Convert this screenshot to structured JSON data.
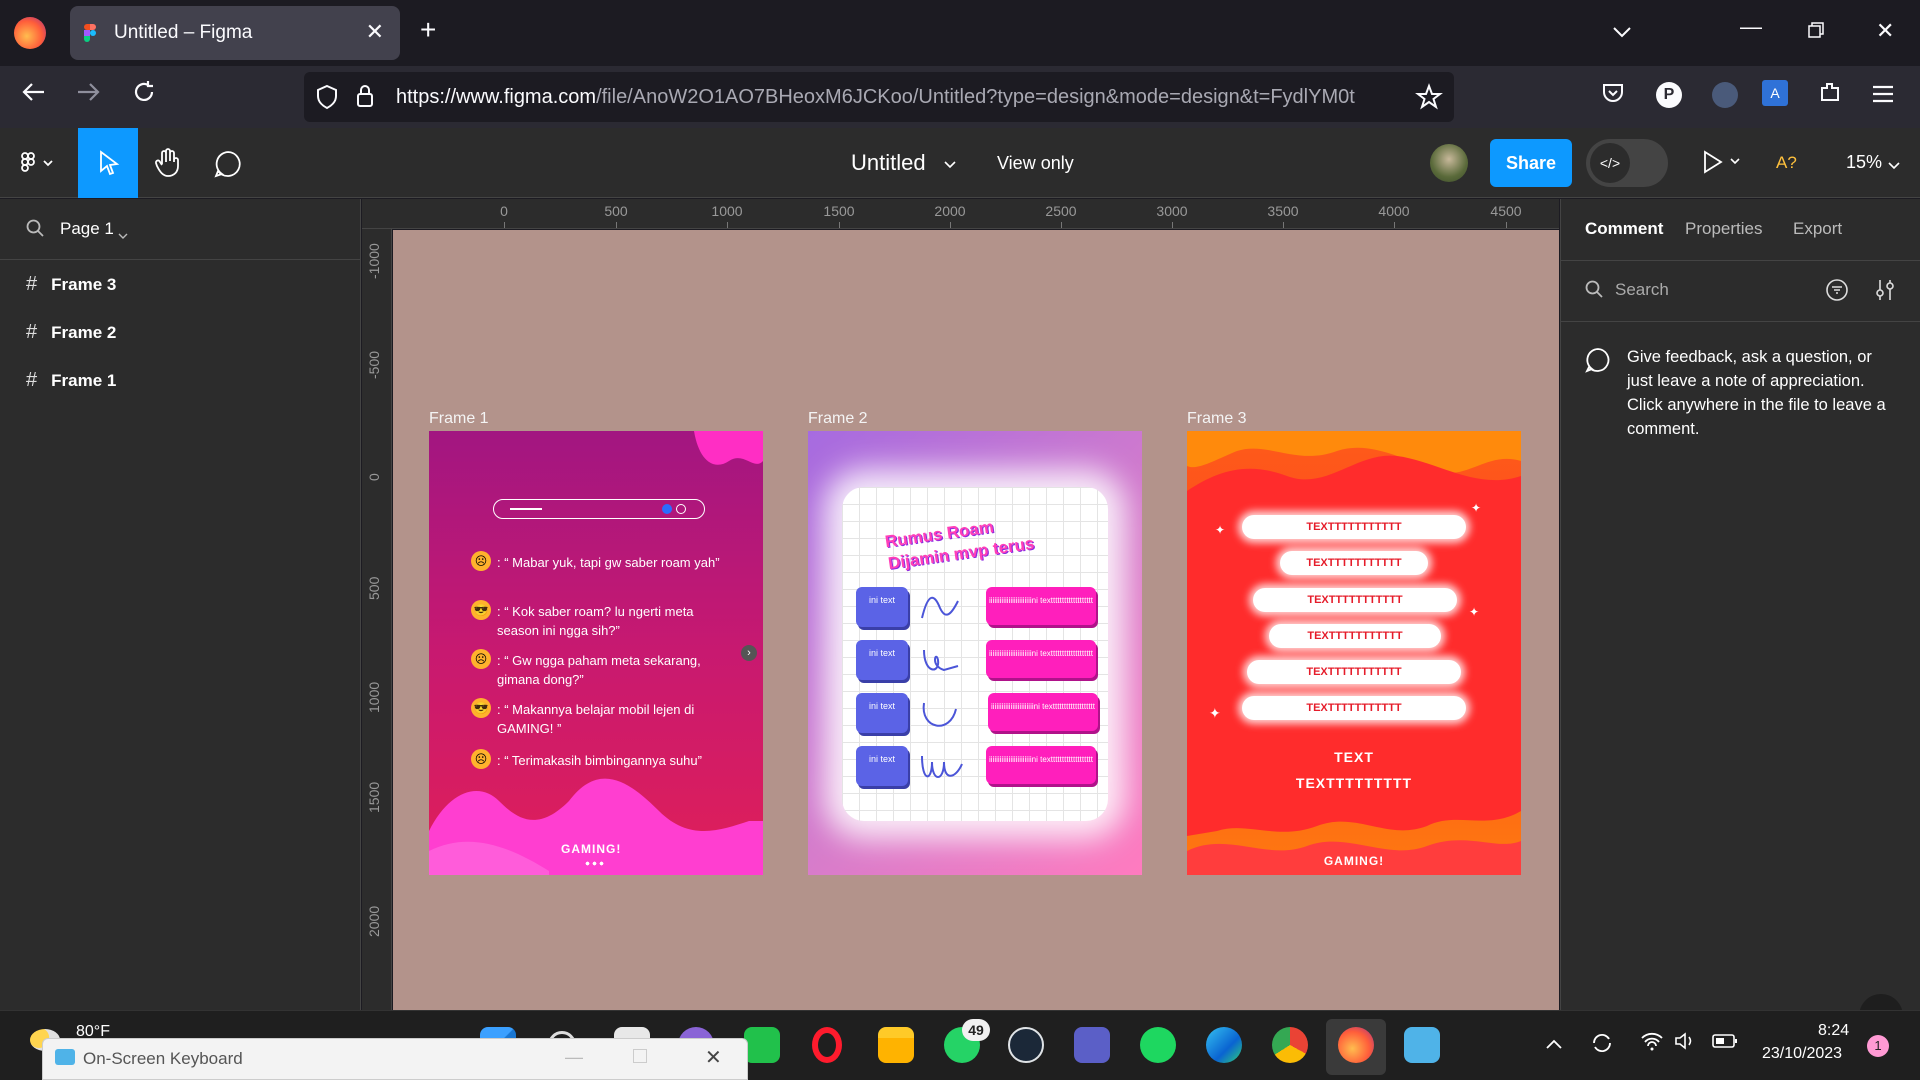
{
  "browser": {
    "tab_title": "Untitled – Figma",
    "url_domain": "https://www.figma.com",
    "url_path": "/file/AnoW2O1AO7BHeoxM6JCKoo/Untitled?type=design&mode=design&t=FydlYM0t"
  },
  "figma": {
    "file_title": "Untitled",
    "view_only": "View only",
    "share_label": "Share",
    "ai_label": "A?",
    "zoom": "15%",
    "page": "Page 1",
    "layers": [
      "Frame 3",
      "Frame 2",
      "Frame 1"
    ],
    "ruler_x": [
      "0",
      "500",
      "1000",
      "1500",
      "2000",
      "2500",
      "3000",
      "3500",
      "4000",
      "4500"
    ],
    "ruler_y": [
      "-1000",
      "-500",
      "0",
      "500",
      "1000",
      "1500",
      "2000"
    ],
    "right_tabs": [
      "Comment",
      "Properties",
      "Export"
    ],
    "search_placeholder": "Search",
    "comment_hint": "Give feedback, ask a question, or just leave a note of appreciation. Click anywhere in the file to leave a comment."
  },
  "frames": {
    "labels": [
      "Frame 1",
      "Frame 2",
      "Frame 3"
    ],
    "frame1": {
      "chat": [
        ": “ Mabar yuk, tapi gw saber roam yah”",
        ": “ Kok saber roam? lu ngerti meta season ini ngga sih?”",
        ": “  Gw ngga paham meta sekarang, gimana dong?”",
        ": “ Makannya belajar mobil lejen di GAMING!  ”",
        ": “ Terimakasih bimbingannya suhu”"
      ],
      "footer": "GAMING!"
    },
    "frame2": {
      "title_line1": "Rumus Roam",
      "title_line2": "Dijamin mvp terus",
      "left_box_text": "ini text",
      "right_box_text": "iiiiiiiiiiiiiiiiiiiiiiiini texttttttttttttttttttt"
    },
    "frame3": {
      "pills": [
        "TEXTTTTTTTTTTT",
        "TEXTTTTTTTTTTT",
        "TEXTTTTTTTTTTT",
        "TEXTTTTTTTTTTT",
        "TEXTTTTTTTTTTT",
        "TEXTTTTTTTTTTT"
      ],
      "text1": "TEXT",
      "text2": "TEXTTTTTTTTT",
      "footer": "GAMING!"
    }
  },
  "taskbar": {
    "weather": "80°F",
    "osk_title": "On-Screen Keyboard",
    "whatsapp_badge": "49",
    "time": "8:24",
    "date": "23/10/2023",
    "notif_count": "1"
  },
  "colors": {
    "accent": "#0d99ff",
    "canvas": "#b3938b",
    "frame1_grad": [
      "#a21681",
      "#e01f58"
    ],
    "frame2_grad": [
      "#a66be0",
      "#ff7bbf"
    ],
    "frame3_grad": [
      "#f9481d",
      "#ff8a0c"
    ]
  }
}
